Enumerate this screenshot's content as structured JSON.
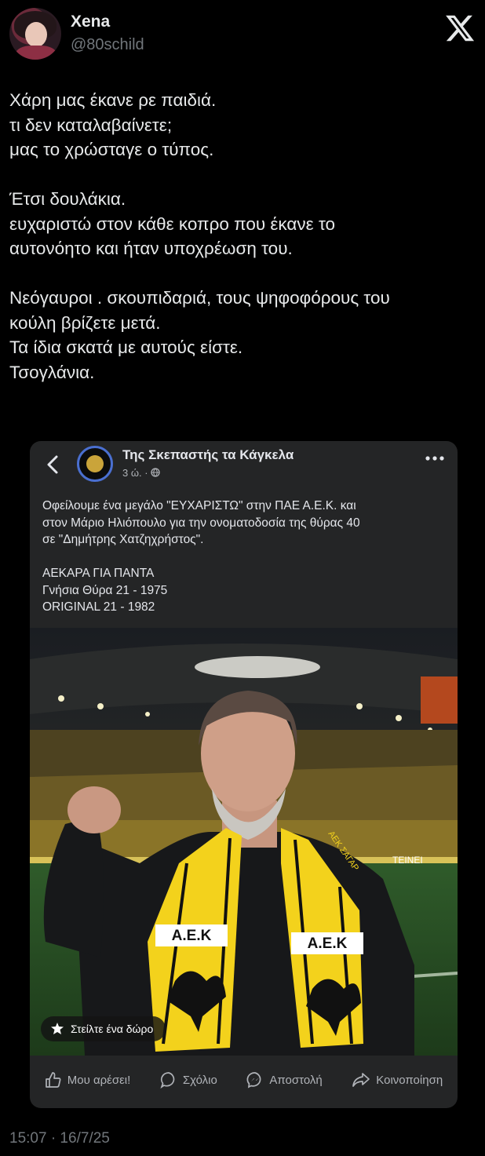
{
  "tweet": {
    "display_name": "Xena",
    "handle": "@80schild",
    "text": "Χάρη μας έκανε ρε παιδιά.\nτι δεν καταλαβαίνετε;\nμας το χρώσταγε ο τύπος.\n\nΈτσι δουλάκια.\nευχαριστώ στον κάθε κοπρο που έκανε το\nαυτονόητο και ήταν υποχρέωση του.\n\nΝεόγαυροι . σκουπιδαριά, τους ψηφοφόρους του\nκούλη βρίζετε μετά.\nΤα ίδια σκατά με αυτούς είστε.\nΤσογλάνια.",
    "timestamp": "15:07 · 16/7/25"
  },
  "embedded_post": {
    "page_name": "Της Σκεπαστής τα Κάγκελα",
    "meta": "3 ώ. · ",
    "body": "Οφείλουμε ένα μεγάλο \"ΕΥΧΑΡΙΣΤΩ\" στην ΠΑΕ Α.Ε.Κ. και\nστον Μάριο Ηλιόπουλο για την ονοματοδοσία της θύρας 40\nσε \"Δημήτρης Χατζηχρήστος\".\n\nΑΕΚΑΡΑ ΓΙΑ ΠΑΝΤΑ\nΓνήσια Θύρα 21 - 1975\nORIGINAL 21 - 1982",
    "gift_label": "Στείλτε ένα δώρο",
    "actions": {
      "like": "Μου αρέσει!",
      "comment": "Σχόλιο",
      "send": "Αποστολή",
      "share": "Κοινοποίηση"
    },
    "scarf_text": "Α.Ε.Κ",
    "scarf_side_text": "ΑΕΚ ΣΑΓΑΡ",
    "banner_text": "ΤΕΙΝΕΙ"
  },
  "colors": {
    "background": "#000000",
    "card": "#242526",
    "text_primary": "#e7e9ea",
    "text_secondary": "#71767b",
    "aek_yellow": "#f3d21c"
  },
  "icons": [
    "x-logo-icon",
    "back-chevron-icon",
    "globe-icon",
    "more-dots-icon",
    "gift-icon",
    "like-icon",
    "comment-icon",
    "messenger-icon",
    "share-icon"
  ]
}
